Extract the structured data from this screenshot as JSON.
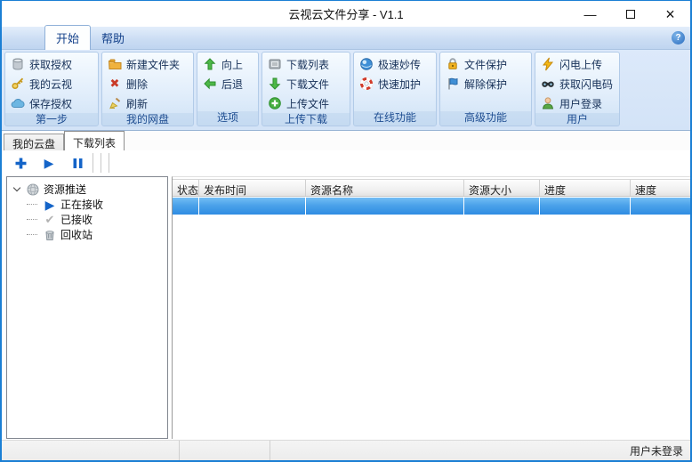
{
  "window": {
    "title": "云视云文件分享 - V1.1",
    "controls": {
      "minimize": "—",
      "close": "×"
    }
  },
  "menu_tabs": {
    "start": "开始",
    "help": "帮助"
  },
  "glyphs": {
    "help": "?",
    "delete": "✖",
    "play": "▶",
    "check": "✔"
  },
  "ribbon": {
    "groups": [
      {
        "label": "第一步",
        "items": [
          {
            "label": "获取授权",
            "icon": "database-icon"
          },
          {
            "label": "我的云视",
            "icon": "key-icon"
          },
          {
            "label": "保存授权",
            "icon": "cloud-icon"
          }
        ]
      },
      {
        "label": "我的网盘",
        "items": [
          {
            "label": "新建文件夹",
            "icon": "new-folder-icon"
          },
          {
            "label": "删除",
            "icon": "delete-icon"
          },
          {
            "label": "刷新",
            "icon": "refresh-brush-icon"
          }
        ]
      },
      {
        "label": "选项",
        "items": [
          {
            "label": "向上",
            "icon": "up-arrow-icon"
          },
          {
            "label": "后退",
            "icon": "back-arrow-icon"
          }
        ]
      },
      {
        "label": "上传下载",
        "items": [
          {
            "label": "下载列表",
            "icon": "download-list-icon"
          },
          {
            "label": "下载文件",
            "icon": "download-file-icon"
          },
          {
            "label": "上传文件",
            "icon": "upload-file-icon"
          }
        ]
      },
      {
        "label": "在线功能",
        "items": [
          {
            "label": "极速妙传",
            "icon": "speed-transfer-globe-icon"
          },
          {
            "label": "快速加护",
            "icon": "lifebuoy-icon"
          }
        ]
      },
      {
        "label": "高级功能",
        "items": [
          {
            "label": "文件保护",
            "icon": "lock-icon"
          },
          {
            "label": "解除保护",
            "icon": "flag-icon"
          }
        ]
      },
      {
        "label": "用户",
        "items": [
          {
            "label": "闪电上传",
            "icon": "lightning-icon"
          },
          {
            "label": "获取闪电码",
            "icon": "binoculars-icon"
          },
          {
            "label": "用户登录",
            "icon": "user-icon"
          }
        ]
      }
    ]
  },
  "page_tabs": {
    "cloud_disk": "我的云盘",
    "download_list": "下载列表"
  },
  "toolbar": {
    "buttons": [
      "add",
      "start",
      "pause"
    ]
  },
  "tree": {
    "root": "资源推送",
    "children": [
      {
        "label": "正在接收",
        "icon": "play-icon"
      },
      {
        "label": "已接收",
        "icon": "check-icon"
      },
      {
        "label": "回收站",
        "icon": "recycle-bin-icon"
      }
    ]
  },
  "table": {
    "columns": [
      "状态",
      "发布时间",
      "资源名称",
      "资源大小",
      "进度",
      "速度"
    ],
    "rows": [
      {
        "selected": true,
        "cells": [
          "",
          "",
          "",
          "",
          "",
          ""
        ]
      }
    ]
  },
  "status_bar": {
    "user_status": "用户未登录"
  },
  "colors": {
    "window_border": "#1b7fd4",
    "ribbon_background": "#d8e6f8",
    "group_label_text": "#1e4d91",
    "selection_blue": "#2f8ce2",
    "toolbar_icon_blue": "#1464c8"
  }
}
